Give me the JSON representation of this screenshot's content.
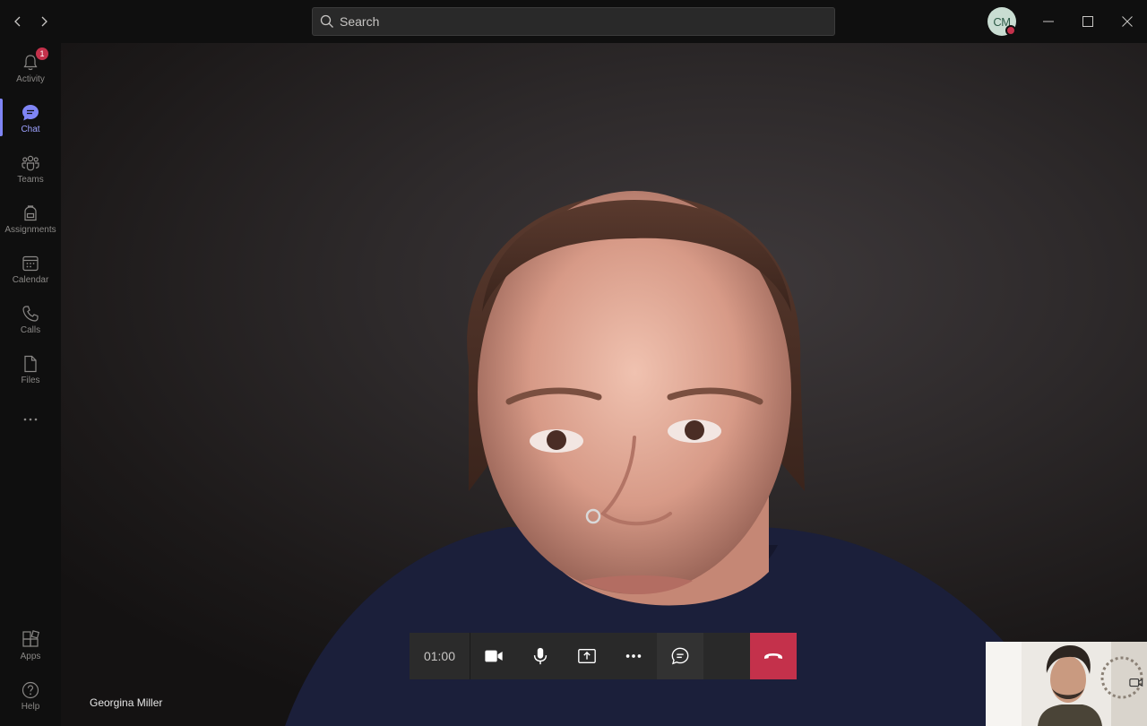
{
  "search": {
    "placeholder": "Search"
  },
  "user": {
    "initials": "CM",
    "presence_color": "#c4314b"
  },
  "sidebar": {
    "items": [
      {
        "label": "Activity",
        "icon": "bell-icon",
        "badge": "1"
      },
      {
        "label": "Chat",
        "icon": "chat-icon",
        "active": true
      },
      {
        "label": "Teams",
        "icon": "teams-icon"
      },
      {
        "label": "Assignments",
        "icon": "backpack-icon"
      },
      {
        "label": "Calendar",
        "icon": "calendar-icon"
      },
      {
        "label": "Calls",
        "icon": "phone-icon"
      },
      {
        "label": "Files",
        "icon": "file-icon"
      }
    ],
    "more_icon": "more-horizontal-icon",
    "bottom_items": [
      {
        "label": "Apps",
        "icon": "apps-icon"
      },
      {
        "label": "Help",
        "icon": "help-icon"
      }
    ]
  },
  "call": {
    "participant_name": "Georgina Miller",
    "timer": "01:00",
    "hangup_color": "#c4314b"
  },
  "colors": {
    "accent": "#7f85f5",
    "background": "#0f0f0f"
  }
}
